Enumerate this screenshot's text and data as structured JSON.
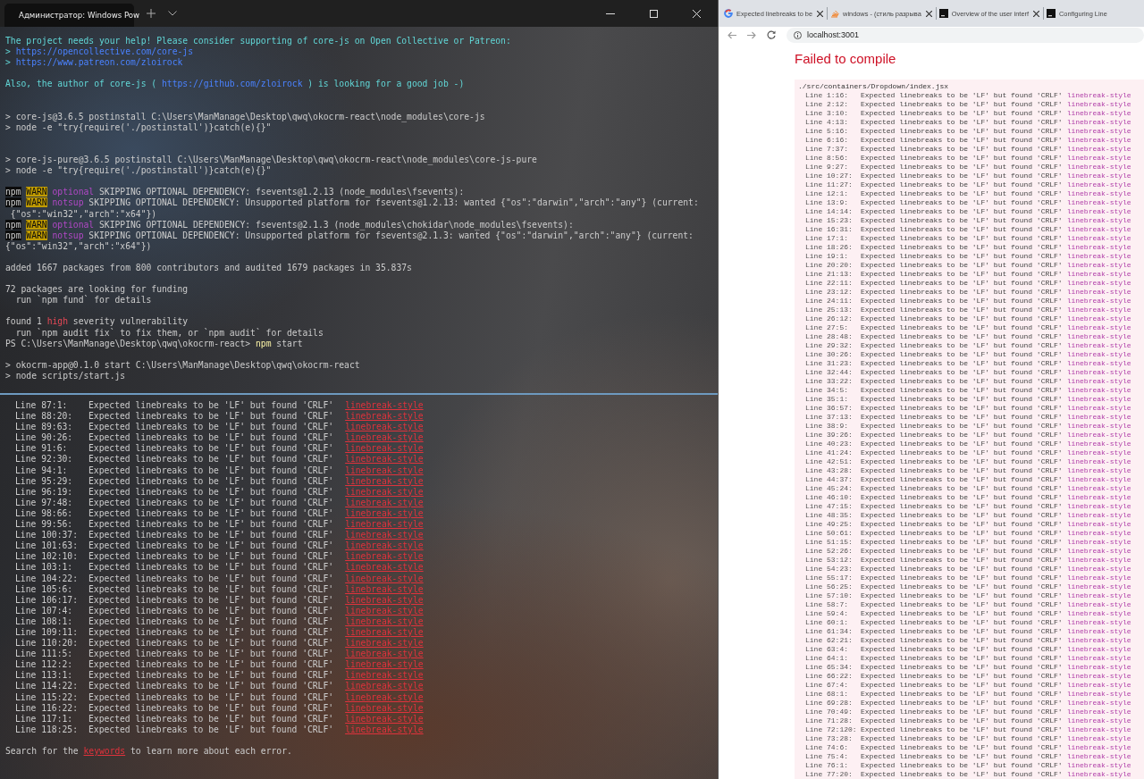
{
  "terminal": {
    "tab_title": "Администратор: Windows Pow",
    "blocks": [
      {
        "kind": "notice",
        "lines": [
          [
            {
              "kind": "cyan",
              "text": "The project needs your help! Please consider supporting of core-js on Open Collective or Patreon:"
            }
          ],
          [
            {
              "kind": "cyan",
              "text": "> "
            },
            {
              "kind": "link",
              "text": "https://opencollective.com/core-js"
            }
          ],
          [
            {
              "kind": "cyan",
              "text": "> "
            },
            {
              "kind": "link",
              "text": "https://www.patreon.com/zloirock"
            }
          ]
        ]
      },
      {
        "kind": "notice",
        "lines": [
          [
            {
              "kind": "cyan",
              "text": "Also, the author of core-js ( "
            },
            {
              "kind": "link",
              "text": "https://github.com/zloirock"
            },
            {
              "kind": "cyan",
              "text": " ) is looking for a good job -)"
            }
          ]
        ]
      },
      {
        "kind": "script",
        "lines": [
          [
            {
              "kind": "text",
              "text": "> core-js@3.6.5 postinstall C:\\Users\\ManManage\\Desktop\\qwq\\okocrm-react\\node_modules\\core-js"
            }
          ],
          [
            {
              "kind": "text",
              "text": "> node -e \"try{require('./postinstall')}catch(e){}\""
            }
          ]
        ]
      },
      {
        "kind": "script",
        "lines": [
          [
            {
              "kind": "text",
              "text": "> core-js-pure@3.6.5 postinstall C:\\Users\\ManManage\\Desktop\\qwq\\okocrm-react\\node_modules\\core-js-pure"
            }
          ],
          [
            {
              "kind": "text",
              "text": "> node -e \"try{require('./postinstall')}catch(e){}\""
            }
          ]
        ]
      },
      {
        "kind": "log",
        "lines": [
          [
            {
              "kind": "npm",
              "text": "npm"
            },
            {
              "kind": "warn",
              "text": "WARN"
            },
            {
              "kind": "tag",
              "text": "optional"
            },
            {
              "kind": "text",
              "text": " SKIPPING OPTIONAL DEPENDENCY: fsevents@1.2.13 (node_modules\\fsevents):"
            }
          ],
          [
            {
              "kind": "npm",
              "text": "npm"
            },
            {
              "kind": "warn",
              "text": "WARN"
            },
            {
              "kind": "tag",
              "text": "notsup"
            },
            {
              "kind": "text",
              "text": " SKIPPING OPTIONAL DEPENDENCY: Unsupported platform for fsevents@1.2.13: wanted {\"os\":\"darwin\",\"arch\":\"any\"} (current:"
            }
          ],
          [
            {
              "kind": "text",
              "text": " {\"os\":\"win32\",\"arch\":\"x64\"})"
            }
          ],
          [
            {
              "kind": "npm",
              "text": "npm"
            },
            {
              "kind": "warn",
              "text": "WARN"
            },
            {
              "kind": "tag",
              "text": "optional"
            },
            {
              "kind": "text",
              "text": " SKIPPING OPTIONAL DEPENDENCY: fsevents@2.1.3 (node_modules\\chokidar\\node_modules\\fsevents):"
            }
          ],
          [
            {
              "kind": "npm",
              "text": "npm"
            },
            {
              "kind": "warn",
              "text": "WARN"
            },
            {
              "kind": "tag",
              "text": "notsup"
            },
            {
              "kind": "text",
              "text": " SKIPPING OPTIONAL DEPENDENCY: Unsupported platform for fsevents@2.1.3: wanted {\"os\":\"darwin\",\"arch\":\"any\"} (current:"
            }
          ],
          [
            {
              "kind": "text",
              "text": "{\"os\":\"win32\",\"arch\":\"x64\"})"
            }
          ]
        ]
      },
      {
        "kind": "log",
        "lines": [
          [
            {
              "kind": "text",
              "text": "added 1667 packages from 800 contributors and audited 1679 packages in 35.837s"
            }
          ]
        ]
      },
      {
        "kind": "log",
        "lines": [
          [
            {
              "kind": "text",
              "text": "72 packages are looking for funding"
            }
          ],
          [
            {
              "kind": "text",
              "text": "  run `npm fund` for details"
            }
          ]
        ]
      },
      {
        "kind": "log",
        "lines": [
          [
            {
              "kind": "text",
              "text": "found 1 "
            },
            {
              "kind": "high",
              "text": "high"
            },
            {
              "kind": "text",
              "text": " severity vulnerability"
            }
          ],
          [
            {
              "kind": "text",
              "text": "  run `npm audit fix` to fix them, or `npm audit` for details"
            }
          ],
          [
            {
              "kind": "text",
              "text": "PS C:\\Users\\ManManage\\Desktop\\qwq\\okocrm-react> "
            },
            {
              "kind": "cmd",
              "text": "npm"
            },
            {
              "kind": "text",
              "text": " start"
            }
          ]
        ]
      },
      {
        "kind": "log",
        "lines": [
          [
            {
              "kind": "text",
              "text": "> okocrm-app@0.1.0 start C:\\Users\\ManManage\\Desktop\\qwq\\okocrm-react"
            }
          ],
          [
            {
              "kind": "text",
              "text": "> node scripts/start.js"
            }
          ]
        ]
      }
    ],
    "errors": [
      {
        "loc": "Line 87:1:",
        "message": "Expected linebreaks to be 'LF' but found 'CRLF'",
        "rule": "linebreak-style"
      },
      {
        "loc": "Line 88:20:",
        "message": "Expected linebreaks to be 'LF' but found 'CRLF'",
        "rule": "linebreak-style"
      },
      {
        "loc": "Line 89:63:",
        "message": "Expected linebreaks to be 'LF' but found 'CRLF'",
        "rule": "linebreak-style"
      },
      {
        "loc": "Line 90:26:",
        "message": "Expected linebreaks to be 'LF' but found 'CRLF'",
        "rule": "linebreak-style"
      },
      {
        "loc": "Line 91:6:",
        "message": "Expected linebreaks to be 'LF' but found 'CRLF'",
        "rule": "linebreak-style"
      },
      {
        "loc": "Line 92:30:",
        "message": "Expected linebreaks to be 'LF' but found 'CRLF'",
        "rule": "linebreak-style"
      },
      {
        "loc": "Line 94:1:",
        "message": "Expected linebreaks to be 'LF' but found 'CRLF'",
        "rule": "linebreak-style"
      },
      {
        "loc": "Line 95:29:",
        "message": "Expected linebreaks to be 'LF' but found 'CRLF'",
        "rule": "linebreak-style"
      },
      {
        "loc": "Line 96:19:",
        "message": "Expected linebreaks to be 'LF' but found 'CRLF'",
        "rule": "linebreak-style"
      },
      {
        "loc": "Line 97:48:",
        "message": "Expected linebreaks to be 'LF' but found 'CRLF'",
        "rule": "linebreak-style"
      },
      {
        "loc": "Line 98:66:",
        "message": "Expected linebreaks to be 'LF' but found 'CRLF'",
        "rule": "linebreak-style"
      },
      {
        "loc": "Line 99:56:",
        "message": "Expected linebreaks to be 'LF' but found 'CRLF'",
        "rule": "linebreak-style"
      },
      {
        "loc": "Line 100:37:",
        "message": "Expected linebreaks to be 'LF' but found 'CRLF'",
        "rule": "linebreak-style"
      },
      {
        "loc": "Line 101:63:",
        "message": "Expected linebreaks to be 'LF' but found 'CRLF'",
        "rule": "linebreak-style"
      },
      {
        "loc": "Line 102:10:",
        "message": "Expected linebreaks to be 'LF' but found 'CRLF'",
        "rule": "linebreak-style"
      },
      {
        "loc": "Line 103:1:",
        "message": "Expected linebreaks to be 'LF' but found 'CRLF'",
        "rule": "linebreak-style"
      },
      {
        "loc": "Line 104:22:",
        "message": "Expected linebreaks to be 'LF' but found 'CRLF'",
        "rule": "linebreak-style"
      },
      {
        "loc": "Line 105:6:",
        "message": "Expected linebreaks to be 'LF' but found 'CRLF'",
        "rule": "linebreak-style"
      },
      {
        "loc": "Line 106:17:",
        "message": "Expected linebreaks to be 'LF' but found 'CRLF'",
        "rule": "linebreak-style"
      },
      {
        "loc": "Line 107:4:",
        "message": "Expected linebreaks to be 'LF' but found 'CRLF'",
        "rule": "linebreak-style"
      },
      {
        "loc": "Line 108:1:",
        "message": "Expected linebreaks to be 'LF' but found 'CRLF'",
        "rule": "linebreak-style"
      },
      {
        "loc": "Line 109:11:",
        "message": "Expected linebreaks to be 'LF' but found 'CRLF'",
        "rule": "linebreak-style"
      },
      {
        "loc": "Line 110:20:",
        "message": "Expected linebreaks to be 'LF' but found 'CRLF'",
        "rule": "linebreak-style"
      },
      {
        "loc": "Line 111:5:",
        "message": "Expected linebreaks to be 'LF' but found 'CRLF'",
        "rule": "linebreak-style"
      },
      {
        "loc": "Line 112:2:",
        "message": "Expected linebreaks to be 'LF' but found 'CRLF'",
        "rule": "linebreak-style"
      },
      {
        "loc": "Line 113:1:",
        "message": "Expected linebreaks to be 'LF' but found 'CRLF'",
        "rule": "linebreak-style"
      },
      {
        "loc": "Line 114:22:",
        "message": "Expected linebreaks to be 'LF' but found 'CRLF'",
        "rule": "linebreak-style"
      },
      {
        "loc": "Line 115:22:",
        "message": "Expected linebreaks to be 'LF' but found 'CRLF'",
        "rule": "linebreak-style"
      },
      {
        "loc": "Line 116:22:",
        "message": "Expected linebreaks to be 'LF' but found 'CRLF'",
        "rule": "linebreak-style"
      },
      {
        "loc": "Line 117:1:",
        "message": "Expected linebreaks to be 'LF' but found 'CRLF'",
        "rule": "linebreak-style"
      },
      {
        "loc": "Line 118:25:",
        "message": "Expected linebreaks to be 'LF' but found 'CRLF'",
        "rule": "linebreak-style"
      }
    ],
    "footer": {
      "before": "Search for the ",
      "link": "keywords",
      "after": " to learn more about each error."
    }
  },
  "browser": {
    "tabs": [
      {
        "title": "Expected linebreaks to be",
        "kind": "search",
        "selected": false
      },
      {
        "title": "windows - (стиль разрыва",
        "kind": "forum",
        "selected": false
      },
      {
        "title": "Overview of the user interf",
        "kind": "docs",
        "selected": false
      },
      {
        "title": "Configuring Line",
        "kind": "docs",
        "selected": false
      }
    ],
    "address": "localhost:3001",
    "heading": "Failed to compile",
    "file": "./src/containers/Dropdown/index.jsx",
    "errors": [
      {
        "loc": "Line 1:16:",
        "message": "Expected linebreaks to be 'LF' but found 'CRLF'",
        "rule": "linebreak-style"
      },
      {
        "loc": "Line 2:12:",
        "message": "Expected linebreaks to be 'LF' but found 'CRLF'",
        "rule": "linebreak-style"
      },
      {
        "loc": "Line 3:10:",
        "message": "Expected linebreaks to be 'LF' but found 'CRLF'",
        "rule": "linebreak-style"
      },
      {
        "loc": "Line 4:13:",
        "message": "Expected linebreaks to be 'LF' but found 'CRLF'",
        "rule": "linebreak-style"
      },
      {
        "loc": "Line 5:16:",
        "message": "Expected linebreaks to be 'LF' but found 'CRLF'",
        "rule": "linebreak-style"
      },
      {
        "loc": "Line 6:16:",
        "message": "Expected linebreaks to be 'LF' but found 'CRLF'",
        "rule": "linebreak-style"
      },
      {
        "loc": "Line 7:37:",
        "message": "Expected linebreaks to be 'LF' but found 'CRLF'",
        "rule": "linebreak-style"
      },
      {
        "loc": "Line 8:56:",
        "message": "Expected linebreaks to be 'LF' but found 'CRLF'",
        "rule": "linebreak-style"
      },
      {
        "loc": "Line 9:27:",
        "message": "Expected linebreaks to be 'LF' but found 'CRLF'",
        "rule": "linebreak-style"
      },
      {
        "loc": "Line 10:27:",
        "message": "Expected linebreaks to be 'LF' but found 'CRLF'",
        "rule": "linebreak-style"
      },
      {
        "loc": "Line 11:27:",
        "message": "Expected linebreaks to be 'LF' but found 'CRLF'",
        "rule": "linebreak-style"
      },
      {
        "loc": "Line 12:1:",
        "message": "Expected linebreaks to be 'LF' but found 'CRLF'",
        "rule": "linebreak-style"
      },
      {
        "loc": "Line 13:9:",
        "message": "Expected linebreaks to be 'LF' but found 'CRLF'",
        "rule": "linebreak-style"
      },
      {
        "loc": "Line 14:14:",
        "message": "Expected linebreaks to be 'LF' but found 'CRLF'",
        "rule": "linebreak-style"
      },
      {
        "loc": "Line 15:23:",
        "message": "Expected linebreaks to be 'LF' but found 'CRLF'",
        "rule": "linebreak-style"
      },
      {
        "loc": "Line 16:31:",
        "message": "Expected linebreaks to be 'LF' but found 'CRLF'",
        "rule": "linebreak-style"
      },
      {
        "loc": "Line 17:1:",
        "message": "Expected linebreaks to be 'LF' but found 'CRLF'",
        "rule": "linebreak-style"
      },
      {
        "loc": "Line 18:26:",
        "message": "Expected linebreaks to be 'LF' but found 'CRLF'",
        "rule": "linebreak-style"
      },
      {
        "loc": "Line 19:1:",
        "message": "Expected linebreaks to be 'LF' but found 'CRLF'",
        "rule": "linebreak-style"
      },
      {
        "loc": "Line 20:20:",
        "message": "Expected linebreaks to be 'LF' but found 'CRLF'",
        "rule": "linebreak-style"
      },
      {
        "loc": "Line 21:13:",
        "message": "Expected linebreaks to be 'LF' but found 'CRLF'",
        "rule": "linebreak-style"
      },
      {
        "loc": "Line 22:11:",
        "message": "Expected linebreaks to be 'LF' but found 'CRLF'",
        "rule": "linebreak-style"
      },
      {
        "loc": "Line 23:12:",
        "message": "Expected linebreaks to be 'LF' but found 'CRLF'",
        "rule": "linebreak-style"
      },
      {
        "loc": "Line 24:11:",
        "message": "Expected linebreaks to be 'LF' but found 'CRLF'",
        "rule": "linebreak-style"
      },
      {
        "loc": "Line 25:13:",
        "message": "Expected linebreaks to be 'LF' but found 'CRLF'",
        "rule": "linebreak-style"
      },
      {
        "loc": "Line 26:12:",
        "message": "Expected linebreaks to be 'LF' but found 'CRLF'",
        "rule": "linebreak-style"
      },
      {
        "loc": "Line 27:5:",
        "message": "Expected linebreaks to be 'LF' but found 'CRLF'",
        "rule": "linebreak-style"
      },
      {
        "loc": "Line 28:48:",
        "message": "Expected linebreaks to be 'LF' but found 'CRLF'",
        "rule": "linebreak-style"
      },
      {
        "loc": "Line 29:32:",
        "message": "Expected linebreaks to be 'LF' but found 'CRLF'",
        "rule": "linebreak-style"
      },
      {
        "loc": "Line 30:26:",
        "message": "Expected linebreaks to be 'LF' but found 'CRLF'",
        "rule": "linebreak-style"
      },
      {
        "loc": "Line 31:23:",
        "message": "Expected linebreaks to be 'LF' but found 'CRLF'",
        "rule": "linebreak-style"
      },
      {
        "loc": "Line 32:44:",
        "message": "Expected linebreaks to be 'LF' but found 'CRLF'",
        "rule": "linebreak-style"
      },
      {
        "loc": "Line 33:22:",
        "message": "Expected linebreaks to be 'LF' but found 'CRLF'",
        "rule": "linebreak-style"
      },
      {
        "loc": "Line 34:5:",
        "message": "Expected linebreaks to be 'LF' but found 'CRLF'",
        "rule": "linebreak-style"
      },
      {
        "loc": "Line 35:1:",
        "message": "Expected linebreaks to be 'LF' but found 'CRLF'",
        "rule": "linebreak-style"
      },
      {
        "loc": "Line 36:57:",
        "message": "Expected linebreaks to be 'LF' but found 'CRLF'",
        "rule": "linebreak-style"
      },
      {
        "loc": "Line 37:13:",
        "message": "Expected linebreaks to be 'LF' but found 'CRLF'",
        "rule": "linebreak-style"
      },
      {
        "loc": "Line 38:9:",
        "message": "Expected linebreaks to be 'LF' but found 'CRLF'",
        "rule": "linebreak-style"
      },
      {
        "loc": "Line 39:26:",
        "message": "Expected linebreaks to be 'LF' but found 'CRLF'",
        "rule": "linebreak-style"
      },
      {
        "loc": "Line 40:23:",
        "message": "Expected linebreaks to be 'LF' but found 'CRLF'",
        "rule": "linebreak-style"
      },
      {
        "loc": "Line 41:24:",
        "message": "Expected linebreaks to be 'LF' but found 'CRLF'",
        "rule": "linebreak-style"
      },
      {
        "loc": "Line 42:51:",
        "message": "Expected linebreaks to be 'LF' but found 'CRLF'",
        "rule": "linebreak-style"
      },
      {
        "loc": "Line 43:28:",
        "message": "Expected linebreaks to be 'LF' but found 'CRLF'",
        "rule": "linebreak-style"
      },
      {
        "loc": "Line 44:37:",
        "message": "Expected linebreaks to be 'LF' but found 'CRLF'",
        "rule": "linebreak-style"
      },
      {
        "loc": "Line 45:24:",
        "message": "Expected linebreaks to be 'LF' but found 'CRLF'",
        "rule": "linebreak-style"
      },
      {
        "loc": "Line 46:10:",
        "message": "Expected linebreaks to be 'LF' but found 'CRLF'",
        "rule": "linebreak-style"
      },
      {
        "loc": "Line 47:15:",
        "message": "Expected linebreaks to be 'LF' but found 'CRLF'",
        "rule": "linebreak-style"
      },
      {
        "loc": "Line 48:35:",
        "message": "Expected linebreaks to be 'LF' but found 'CRLF'",
        "rule": "linebreak-style"
      },
      {
        "loc": "Line 49:25:",
        "message": "Expected linebreaks to be 'LF' but found 'CRLF'",
        "rule": "linebreak-style"
      },
      {
        "loc": "Line 50:61:",
        "message": "Expected linebreaks to be 'LF' but found 'CRLF'",
        "rule": "linebreak-style"
      },
      {
        "loc": "Line 51:15:",
        "message": "Expected linebreaks to be 'LF' but found 'CRLF'",
        "rule": "linebreak-style"
      },
      {
        "loc": "Line 52:26:",
        "message": "Expected linebreaks to be 'LF' but found 'CRLF'",
        "rule": "linebreak-style"
      },
      {
        "loc": "Line 53:12:",
        "message": "Expected linebreaks to be 'LF' but found 'CRLF'",
        "rule": "linebreak-style"
      },
      {
        "loc": "Line 54:23:",
        "message": "Expected linebreaks to be 'LF' but found 'CRLF'",
        "rule": "linebreak-style"
      },
      {
        "loc": "Line 55:17:",
        "message": "Expected linebreaks to be 'LF' but found 'CRLF'",
        "rule": "linebreak-style"
      },
      {
        "loc": "Line 56:25:",
        "message": "Expected linebreaks to be 'LF' but found 'CRLF'",
        "rule": "linebreak-style"
      },
      {
        "loc": "Line 57:10:",
        "message": "Expected linebreaks to be 'LF' but found 'CRLF'",
        "rule": "linebreak-style"
      },
      {
        "loc": "Line 58:7:",
        "message": "Expected linebreaks to be 'LF' but found 'CRLF'",
        "rule": "linebreak-style"
      },
      {
        "loc": "Line 59:4:",
        "message": "Expected linebreaks to be 'LF' but found 'CRLF'",
        "rule": "linebreak-style"
      },
      {
        "loc": "Line 60:1:",
        "message": "Expected linebreaks to be 'LF' but found 'CRLF'",
        "rule": "linebreak-style"
      },
      {
        "loc": "Line 61:34:",
        "message": "Expected linebreaks to be 'LF' but found 'CRLF'",
        "rule": "linebreak-style"
      },
      {
        "loc": "Line 62:21:",
        "message": "Expected linebreaks to be 'LF' but found 'CRLF'",
        "rule": "linebreak-style"
      },
      {
        "loc": "Line 63:4:",
        "message": "Expected linebreaks to be 'LF' but found 'CRLF'",
        "rule": "linebreak-style"
      },
      {
        "loc": "Line 64:1:",
        "message": "Expected linebreaks to be 'LF' but found 'CRLF'",
        "rule": "linebreak-style"
      },
      {
        "loc": "Line 65:34:",
        "message": "Expected linebreaks to be 'LF' but found 'CRLF'",
        "rule": "linebreak-style"
      },
      {
        "loc": "Line 66:22:",
        "message": "Expected linebreaks to be 'LF' but found 'CRLF'",
        "rule": "linebreak-style"
      },
      {
        "loc": "Line 67:4:",
        "message": "Expected linebreaks to be 'LF' but found 'CRLF'",
        "rule": "linebreak-style"
      },
      {
        "loc": "Line 68:1:",
        "message": "Expected linebreaks to be 'LF' but found 'CRLF'",
        "rule": "linebreak-style"
      },
      {
        "loc": "Line 69:28:",
        "message": "Expected linebreaks to be 'LF' but found 'CRLF'",
        "rule": "linebreak-style"
      },
      {
        "loc": "Line 70:49:",
        "message": "Expected linebreaks to be 'LF' but found 'CRLF'",
        "rule": "linebreak-style"
      },
      {
        "loc": "Line 71:28:",
        "message": "Expected linebreaks to be 'LF' but found 'CRLF'",
        "rule": "linebreak-style"
      },
      {
        "loc": "Line 72:120:",
        "message": "Expected linebreaks to be 'LF' but found 'CRLF'",
        "rule": "linebreak-style"
      },
      {
        "loc": "Line 73:28:",
        "message": "Expected linebreaks to be 'LF' but found 'CRLF'",
        "rule": "linebreak-style"
      },
      {
        "loc": "Line 74:6:",
        "message": "Expected linebreaks to be 'LF' but found 'CRLF'",
        "rule": "linebreak-style"
      },
      {
        "loc": "Line 75:4:",
        "message": "Expected linebreaks to be 'LF' but found 'CRLF'",
        "rule": "linebreak-style"
      },
      {
        "loc": "Line 76:1:",
        "message": "Expected linebreaks to be 'LF' but found 'CRLF'",
        "rule": "linebreak-style"
      },
      {
        "loc": "Line 77:20:",
        "message": "Expected linebreaks to be 'LF' but found 'CRLF'",
        "rule": "linebreak-style"
      }
    ]
  }
}
